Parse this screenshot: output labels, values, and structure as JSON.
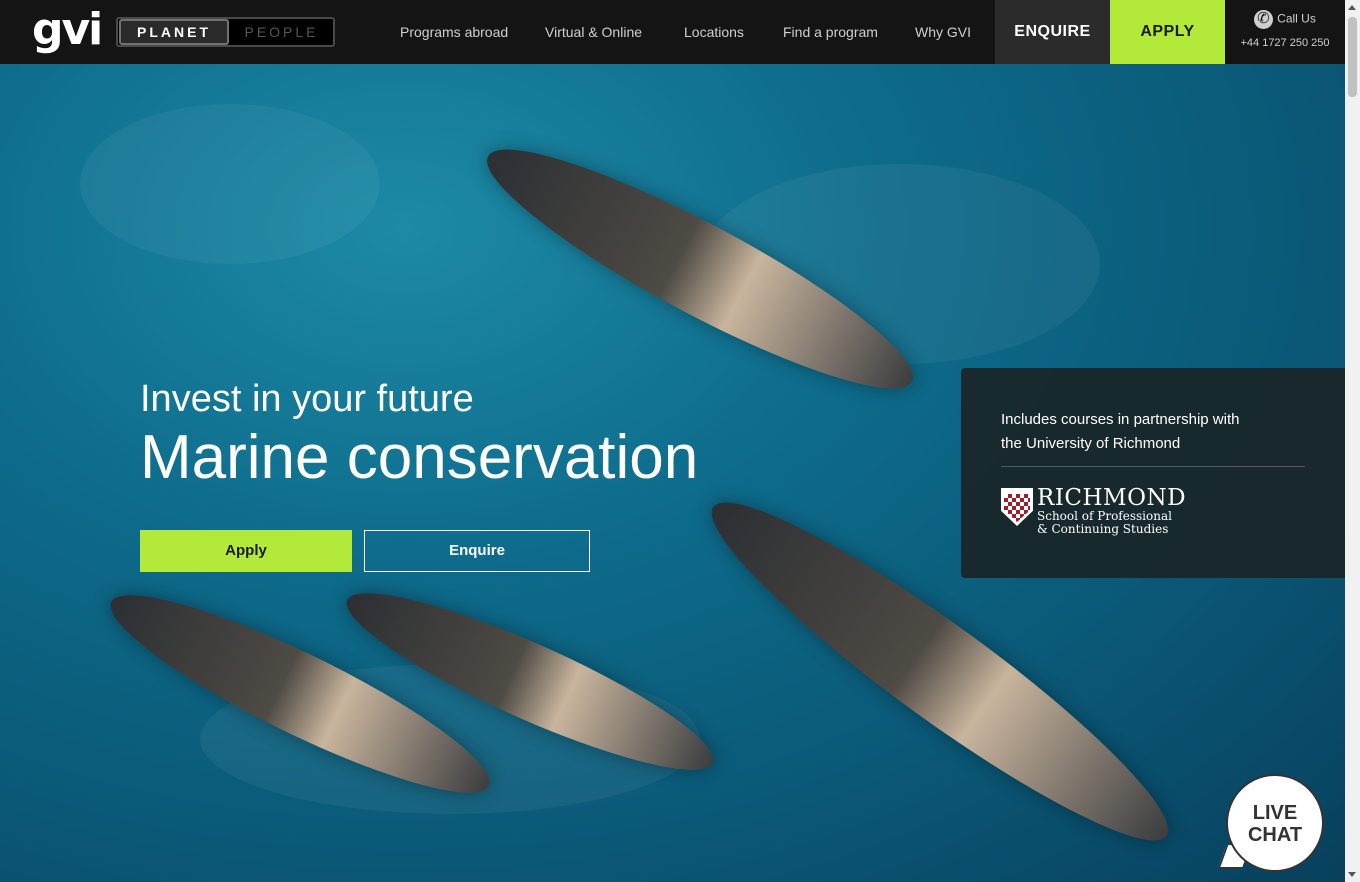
{
  "header": {
    "logo": "gvi",
    "toggle": {
      "planet": "PLANET",
      "people": "PEOPLE"
    },
    "nav": [
      "Programs abroad",
      "Virtual & Online",
      "Locations",
      "Find a program",
      "Why GVI"
    ],
    "enquire": "ENQUIRE",
    "apply": "APPLY",
    "call_label": "Call Us",
    "phone": "+44 1727 250 250"
  },
  "hero": {
    "subtitle": "Invest in your future",
    "title": "Marine conservation",
    "apply_button": "Apply",
    "enquire_button": "Enquire"
  },
  "partner": {
    "text": "Includes courses in partnership with the University of Richmond",
    "logo_name": "RICHMOND",
    "logo_line1": "School of Professional",
    "logo_line2": "& Continuing Studies"
  },
  "livechat": {
    "line1": "LIVE",
    "line2": "CHAT"
  },
  "colors": {
    "accent": "#b3ea39",
    "header_bg": "#141414",
    "sea": "#0e6c8c"
  }
}
